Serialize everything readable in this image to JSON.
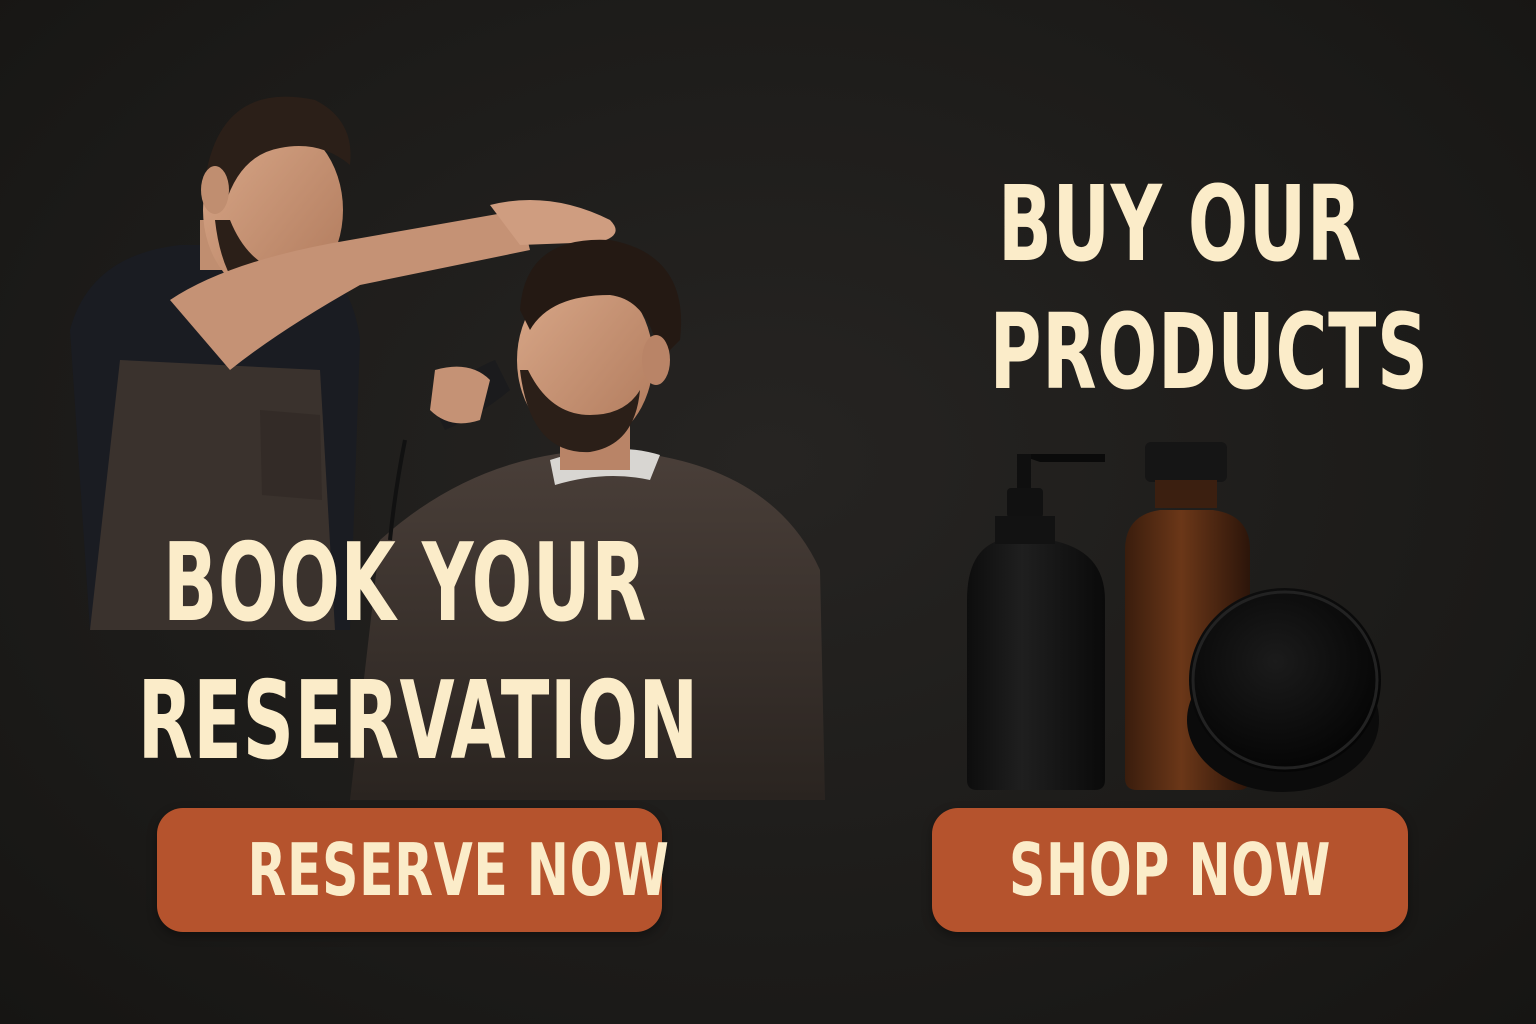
{
  "reservation": {
    "headline_line1": "BOOK YOUR",
    "headline_line2": "RESERVATION",
    "button_label": "RESERVE NOW",
    "illustration": "barber-trimming-client-beard"
  },
  "products": {
    "headline_line1": "BUY OUR",
    "headline_line2": "PRODUCTS",
    "button_label": "SHOP NOW",
    "items": [
      "pump-bottle",
      "amber-bottle",
      "pomade-tin"
    ]
  },
  "colors": {
    "background": "#1c1b19",
    "headline": "#fbecc9",
    "button": "#b5532d",
    "button_text": "#fbecc9"
  }
}
